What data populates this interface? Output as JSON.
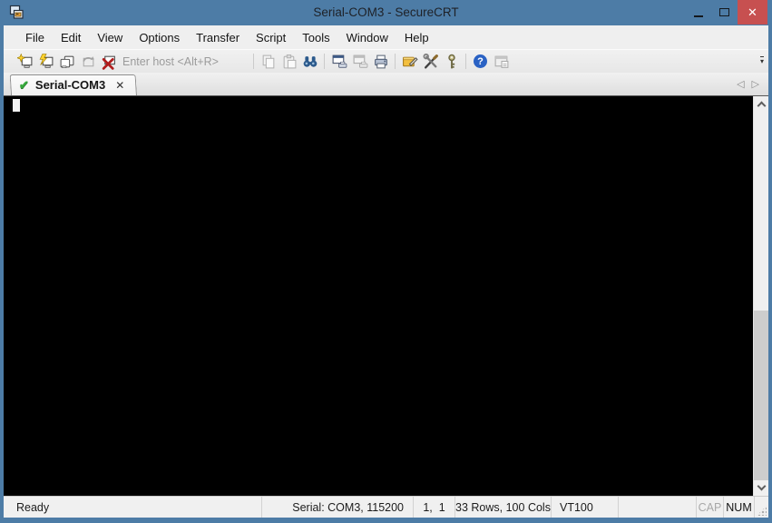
{
  "colors": {
    "accent_blue": "#4d7ca6",
    "close_button_red": "#c75050",
    "tab_status_green": "#36a93c",
    "terminal_background": "#000000"
  },
  "titlebar": {
    "title": "Serial-COM3 - SecureCRT",
    "close_glyph": "✕"
  },
  "menubar": {
    "items": [
      "File",
      "Edit",
      "View",
      "Options",
      "Transfer",
      "Script",
      "Tools",
      "Window",
      "Help"
    ]
  },
  "toolbar": {
    "host_placeholder": "Enter host <Alt+R>",
    "help_glyph": "?",
    "overflow_glyph": "▾",
    "icon_names": [
      "connect",
      "quick-connect",
      "connect-in-tab",
      "reconnect",
      "disconnect",
      "copy",
      "paste",
      "find",
      "print-screen",
      "auto-print",
      "print",
      "session-options",
      "global-options",
      "keymap",
      "help",
      "file-transfer"
    ]
  },
  "tabbar": {
    "tabs": [
      {
        "label": "Serial-COM3",
        "status": "connected",
        "status_glyph": "✔",
        "close_glyph": "✕"
      }
    ],
    "scroll_left_glyph": "◁",
    "scroll_right_glyph": "▷"
  },
  "terminal": {
    "cursor_row": 1,
    "cursor_col": 1
  },
  "statusbar": {
    "ready": "Ready",
    "serial": "Serial: COM3, 115200",
    "cursor_position": "1,  1",
    "screen_size": "33 Rows, 100 Cols",
    "emulation": "VT100",
    "caps_lock": "CAP",
    "num_lock": "NUM"
  }
}
